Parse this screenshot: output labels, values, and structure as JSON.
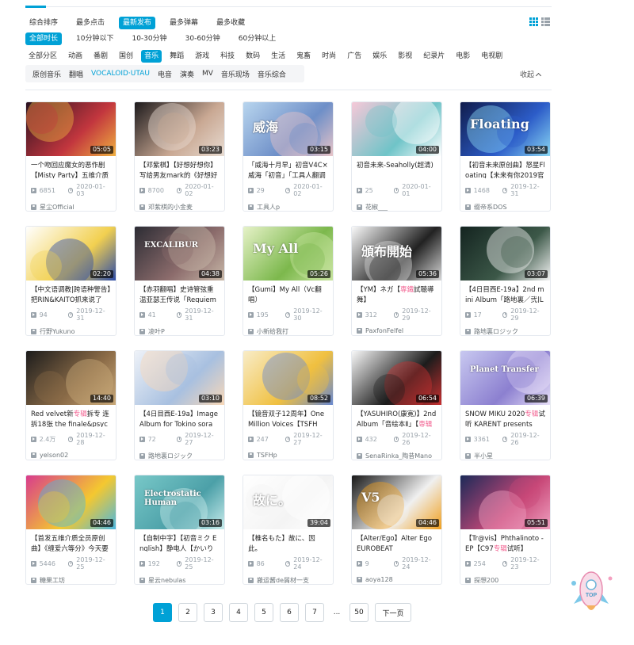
{
  "sort_tabs": [
    {
      "label": "综合排序",
      "active": false
    },
    {
      "label": "最多点击",
      "active": false
    },
    {
      "label": "最新发布",
      "active": true
    },
    {
      "label": "最多弹幕",
      "active": false
    },
    {
      "label": "最多收藏",
      "active": false
    }
  ],
  "duration_filters": [
    {
      "label": "全部时长",
      "active": true
    },
    {
      "label": "10分钟以下",
      "active": false
    },
    {
      "label": "10-30分钟",
      "active": false
    },
    {
      "label": "30-60分钟",
      "active": false
    },
    {
      "label": "60分钟以上",
      "active": false
    }
  ],
  "zones": [
    {
      "label": "全部分区",
      "active": false
    },
    {
      "label": "动画",
      "active": false
    },
    {
      "label": "番剧",
      "active": false
    },
    {
      "label": "国创",
      "active": false
    },
    {
      "label": "音乐",
      "active": true
    },
    {
      "label": "舞蹈",
      "active": false
    },
    {
      "label": "游戏",
      "active": false
    },
    {
      "label": "科技",
      "active": false
    },
    {
      "label": "数码",
      "active": false
    },
    {
      "label": "生活",
      "active": false
    },
    {
      "label": "鬼畜",
      "active": false
    },
    {
      "label": "时尚",
      "active": false
    },
    {
      "label": "广告",
      "active": false
    },
    {
      "label": "娱乐",
      "active": false
    },
    {
      "label": "影视",
      "active": false
    },
    {
      "label": "纪录片",
      "active": false
    },
    {
      "label": "电影",
      "active": false
    },
    {
      "label": "电视剧",
      "active": false
    }
  ],
  "sub_zones": [
    {
      "label": "原创音乐",
      "active": false
    },
    {
      "label": "翻唱",
      "active": false
    },
    {
      "label": "VOCALOID·UTAU",
      "active": true
    },
    {
      "label": "电音",
      "active": false
    },
    {
      "label": "演奏",
      "active": false
    },
    {
      "label": "MV",
      "active": false
    },
    {
      "label": "音乐现场",
      "active": false
    },
    {
      "label": "音乐综合",
      "active": false
    }
  ],
  "collapse_label": "收起",
  "accent_color": "#00a1d6",
  "highlight_color": "#f25d8e",
  "videos": [
    {
      "title_pre": "一个吻回应魔女的恶作剧【Misty Party】五维介质 -",
      "hl": "",
      "title_post": "",
      "duration": "05:05",
      "views": "6851",
      "date": "2020-01-03",
      "uploader": "星尘Official",
      "thumb_colors": [
        "#2a1220",
        "#c2363e",
        "#f0b040"
      ],
      "thumb_text": ""
    },
    {
      "title_pre": "【邓紫棋】【好想好想你】写给男友mark的《好想好想",
      "hl": "",
      "title_post": "",
      "duration": "03:23",
      "views": "8700",
      "date": "2020-01-02",
      "uploader": "邓紫棋的小金麦",
      "thumb_colors": [
        "#1d1a1c",
        "#c9a893",
        "#e8dcd2"
      ],
      "thumb_text": ""
    },
    {
      "title_pre": "「威海十月早」初音V4C×威海「初音」「工具人翻调",
      "hl": "",
      "title_post": "",
      "duration": "03:15",
      "views": "29",
      "date": "2020-01-02",
      "uploader": "工具人p",
      "thumb_colors": [
        "#b8d5ee",
        "#6e8fc8",
        "#e8c4c8"
      ],
      "thumb_text": "威海"
    },
    {
      "title_pre": "初音未来-Seaholly(超清)",
      "hl": "",
      "title_post": "",
      "duration": "04:00",
      "views": "25",
      "date": "2020-01-01",
      "uploader": "花椒___",
      "thumb_colors": [
        "#f6c8d8",
        "#6fc4c8",
        "#ffffff"
      ],
      "thumb_text": ""
    },
    {
      "title_pre": "【初音未来原创曲】怒星Floating【未来有你2019官",
      "hl": "",
      "title_post": "",
      "duration": "03:54",
      "views": "1468",
      "date": "2019-12-31",
      "uploader": "缀帝系DOS",
      "thumb_colors": [
        "#101c4c",
        "#2c5cc8",
        "#8ad8f4"
      ],
      "thumb_text": "Floating"
    },
    {
      "title_pre": "【中文语调教|跨语种警告】把RIN&KAITO抓来说了",
      "hl": "",
      "title_post": "",
      "duration": "02:20",
      "views": "94",
      "date": "2019-12-31",
      "uploader": "行野Yukuno",
      "thumb_colors": [
        "#ffffff",
        "#f2d050",
        "#2c4ca8"
      ],
      "thumb_text": ""
    },
    {
      "title_pre": "【赤羽翻唱】史诗管弦重温亚瑟王传说「Requiem of",
      "hl": "",
      "title_post": "",
      "duration": "04:38",
      "views": "41",
      "date": "2019-12-31",
      "uploader": "凌叶P",
      "thumb_colors": [
        "#2c2c34",
        "#8c6c6c",
        "#c8b8a8"
      ],
      "thumb_text": "EXCALIBUR"
    },
    {
      "title_pre": "【Gumi】My All（Vc翻唱）",
      "hl": "",
      "title_post": "",
      "duration": "05:26",
      "views": "195",
      "date": "2019-12-30",
      "uploader": "小新给我打",
      "thumb_colors": [
        "#e6f2c8",
        "#7cb84c",
        "#c8e4a0"
      ],
      "thumb_text": "My All"
    },
    {
      "title_pre": "【YM】ネガ【",
      "hl": "専鐵",
      "title_post": "試聴導舞】",
      "duration": "05:36",
      "views": "312",
      "date": "2019-12-29",
      "uploader": "PaxfonFelfel",
      "thumb_colors": [
        "#fafafa",
        "#222222",
        "#d8d8d8"
      ],
      "thumb_text": "頒布開始"
    },
    {
      "title_pre": "【4日目西E-19a】2nd mini Album「路地裏／弐|Lojiura",
      "hl": "",
      "title_post": "",
      "duration": "03:07",
      "views": "17",
      "date": "2019-12-29",
      "uploader": "路地裏ロジック",
      "thumb_colors": [
        "#142420",
        "#3c5848",
        "#f4f4f4"
      ],
      "thumb_text": ""
    },
    {
      "title_pre": "Red velvet新",
      "hl": "专辑",
      "title_post": "拆专 连拆18张 the finale&psycho —",
      "duration": "14:40",
      "views": "2.4万",
      "date": "2019-12-28",
      "uploader": "yelson02",
      "thumb_colors": [
        "#1c1c1c",
        "#8c6c48",
        "#c8a878"
      ],
      "thumb_text": ""
    },
    {
      "title_pre": "【4日目西E-19a】Image Album for Tokino sora",
      "hl": "",
      "title_post": "",
      "duration": "03:10",
      "views": "72",
      "date": "2019-12-27",
      "uploader": "路地裏ロジック",
      "thumb_colors": [
        "#eef2f8",
        "#a8c0e0",
        "#f8d8b8"
      ],
      "thumb_text": ""
    },
    {
      "title_pre": "【镜音双子12周年】One Million Voices【TSFH",
      "hl": "",
      "title_post": "",
      "duration": "08:52",
      "views": "247",
      "date": "2019-12-27",
      "uploader": "TSFHp",
      "thumb_colors": [
        "#f8ecc8",
        "#f0c040",
        "#6888d0"
      ],
      "thumb_text": ""
    },
    {
      "title_pre": "【YASUHIRO(康寛)】2nd Album「音绘本Ⅱ」【",
      "hl": "専辑",
      "title_post": "",
      "duration": "06:54",
      "views": "432",
      "date": "2019-12-26",
      "uploader": "SenaRinka_陶昔Mano",
      "thumb_colors": [
        "#f8f8f8",
        "#1c1c1c",
        "#c83030"
      ],
      "thumb_text": ""
    },
    {
      "title_pre": "SNOW MIKU 2020",
      "hl": "专辑",
      "title_post": "试听 KARENT presents",
      "duration": "06:39",
      "views": "3361",
      "date": "2019-12-26",
      "uploader": "半小星",
      "thumb_colors": [
        "#c8c8f0",
        "#8c80d0",
        "#e8e0f8"
      ],
      "thumb_text": "Planet Transfer"
    },
    {
      "title_pre": "【首发五维介质全员原创曲】《缠爱六等分》今天要",
      "hl": "",
      "title_post": "",
      "duration": "04:46",
      "views": "5446",
      "date": "2019-12-25",
      "uploader": "糖果工坊",
      "thumb_colors": [
        "#d83c8c",
        "#f4c830",
        "#4cb8e0"
      ],
      "thumb_text": ""
    },
    {
      "title_pre": "【自制中字】【初音ミク English】静电人【かいりき",
      "hl": "",
      "title_post": "",
      "duration": "03:16",
      "views": "192",
      "date": "2019-12-25",
      "uploader": "星云nebulas",
      "thumb_colors": [
        "#78c8c8",
        "#4ca0a8",
        "#c8ecec"
      ],
      "thumb_text": "Electrostatic Human"
    },
    {
      "title_pre": "【椎名もた】故に、因此。",
      "hl": "",
      "title_post": "",
      "duration": "39:04",
      "views": "86",
      "date": "2019-12-24",
      "uploader": "搬运酱de屑材一支",
      "thumb_colors": [
        "#ffffff",
        "#f4f4f4",
        "#ffffff"
      ],
      "thumb_text": "故に。"
    },
    {
      "title_pre": "【Alter/Ego】Alter Ego EUROBEAT",
      "hl": "",
      "title_post": "",
      "duration": "04:46",
      "views": "9",
      "date": "2019-12-24",
      "uploader": "aoya128",
      "thumb_colors": [
        "#181818",
        "#f0f0f0",
        "#f0a020"
      ],
      "thumb_text": "V5"
    },
    {
      "title_pre": "【Tr@vis】Phthalinoto - EP【C97",
      "hl": "专辑",
      "title_post": "试听】",
      "duration": "05:51",
      "views": "254",
      "date": "2019-12-23",
      "uploader": "探想200",
      "thumb_colors": [
        "#1c2a58",
        "#c84878",
        "#f0a0c0"
      ],
      "thumb_text": ""
    }
  ],
  "pagination": {
    "pages": [
      "1",
      "2",
      "3",
      "4",
      "5",
      "6",
      "7"
    ],
    "current": "1",
    "ellipsis": "...",
    "last": "50",
    "next_label": "下一页"
  },
  "back_to_top_label": "TOP"
}
